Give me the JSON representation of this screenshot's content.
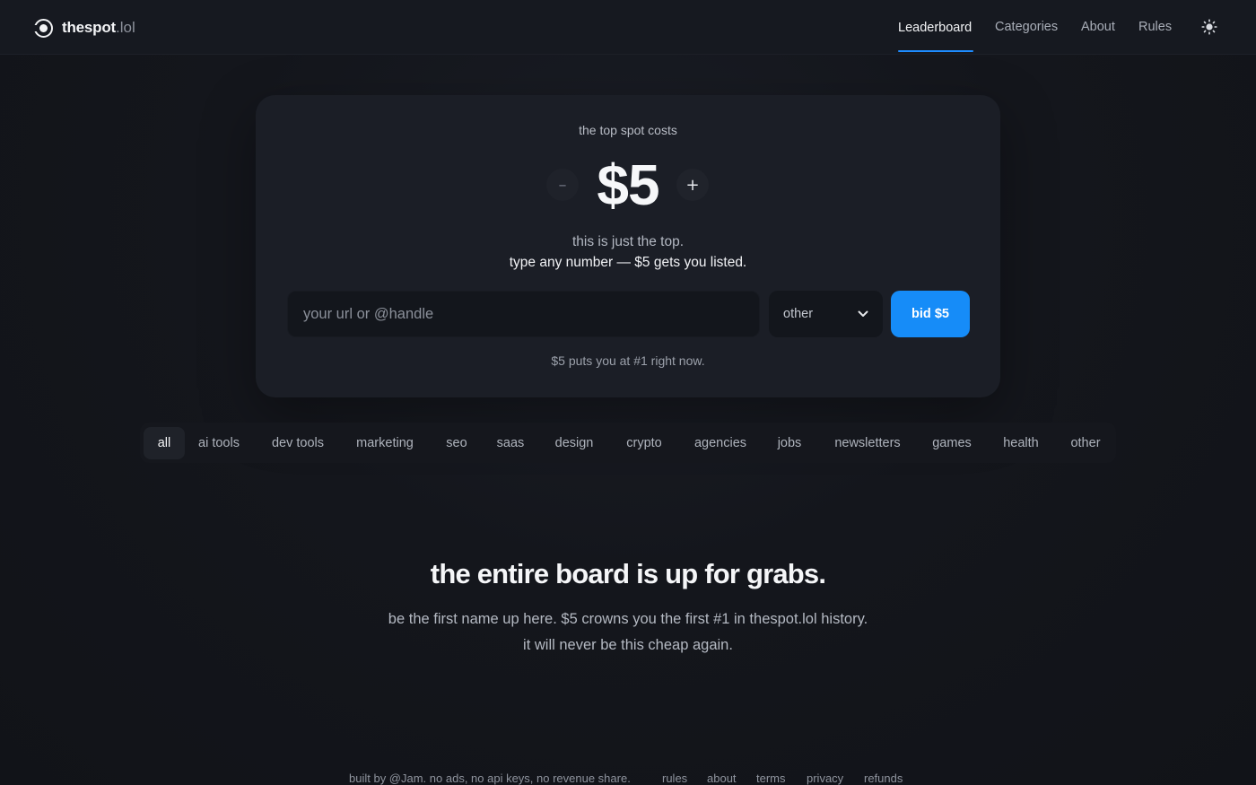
{
  "brand": {
    "name": "thespot",
    "tld": ".lol",
    "logo_icon": "target-icon"
  },
  "nav": {
    "items": [
      {
        "label": "Leaderboard",
        "active": true
      },
      {
        "label": "Categories",
        "active": false
      },
      {
        "label": "About",
        "active": false
      },
      {
        "label": "Rules",
        "active": false
      }
    ],
    "theme_icon": "sun-icon"
  },
  "hero": {
    "kicker": "the top spot costs",
    "price": "$5",
    "decrement_label": "–",
    "increment_label": "+",
    "line1": "this is just the top.",
    "line2": "type any number — $5 gets you listed.",
    "input": {
      "placeholder": "your url or @handle",
      "value": ""
    },
    "category_select": {
      "selected": "other"
    },
    "bid_button": "bid $5",
    "hint": "$5 puts you at #1 right now."
  },
  "filters": {
    "items": [
      "all",
      "ai tools",
      "dev tools",
      "marketing",
      "seo",
      "saas",
      "design",
      "crypto",
      "agencies",
      "jobs",
      "newsletters",
      "games",
      "health",
      "other"
    ],
    "active": "all"
  },
  "empty_state": {
    "title": "the entire board is up for grabs.",
    "line1": "be the first name up here. $5 crowns you the first #1 in thespot.lol history.",
    "line2": "it will never be this cheap again."
  },
  "footer": {
    "credit": "built by @Jam. no ads, no api keys, no revenue share.",
    "links": [
      "rules",
      "about",
      "terms",
      "privacy",
      "refunds"
    ]
  },
  "colors": {
    "accent": "#168cf8",
    "background": "#121419",
    "card": "#1b1e26"
  }
}
